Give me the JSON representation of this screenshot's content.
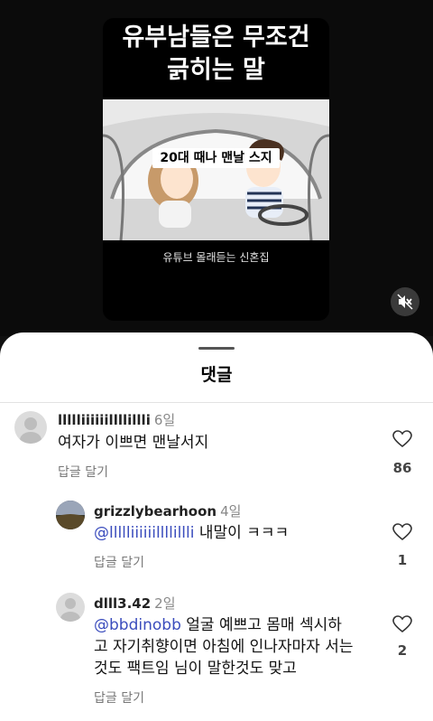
{
  "video": {
    "title_line1": "유부남들은 무조건",
    "title_line2": "긁히는 말",
    "subtitle_caption": "20대 때나 맨날 스지",
    "credit": "유튜브 몰래듣는 신혼집"
  },
  "sheet": {
    "title": "댓글"
  },
  "comments": [
    {
      "username": "llllliiiiiillllillli",
      "time": "6일",
      "text": "여자가 이쁘면 맨날서지",
      "reply_label": "답글 달기",
      "likes": "86"
    },
    {
      "username": "grizzlybearhoon",
      "time": "4일",
      "mention": "@llllliiiiiillllillli",
      "text": "내말이 ㅋㅋㅋ",
      "reply_label": "답글 달기",
      "likes": "1"
    },
    {
      "username": "dlll3.42",
      "time": "2일",
      "mention": "@bbdinobb",
      "text_line1": " 얼굴 예쁘고 몸매 섹시하",
      "text_line2": "고 자기취향이면 아침에 인나자마자 서는",
      "text_line3": "것도 팩트임 님이 말한것도 맞고",
      "reply_label": "답글 달기",
      "likes": "2"
    }
  ],
  "icons": {
    "mute": "speaker-muted-icon",
    "like": "heart-outline-icon"
  },
  "colors": {
    "mention": "#3b4dbd",
    "background_top": "#0b0b0b",
    "sheet": "#ffffff"
  }
}
